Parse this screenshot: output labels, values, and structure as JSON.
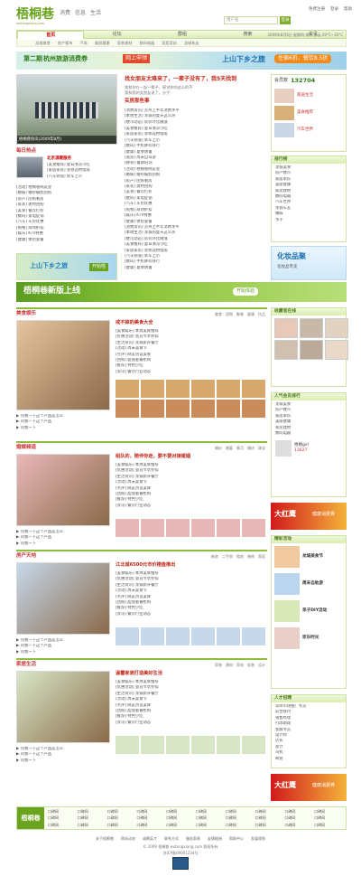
{
  "header": {
    "logo": "梧桐巷",
    "logo_sub": "wutongxiang.com",
    "tabs": [
      "消费",
      "信息",
      "生活"
    ],
    "toplinks": [
      "免费注册",
      "登录",
      "帮助"
    ],
    "search_placeholder": "用户名",
    "search_btn": "登录",
    "nav": [
      "首页",
      "论坛",
      "群组",
      "搜索",
      "资讯"
    ],
    "subnav": [
      "龙城美食",
      "房产楼市",
      "汽车",
      "美丽健康",
      "家装建材",
      "数码电器",
      "家居家纺",
      "龙城车友"
    ],
    "weather": "2009年8月6日 星期四 常州 多云 29°C~33°C"
  },
  "banner": {
    "left": "第二期",
    "mid": "杭州旅游消费券",
    "chip": "网上申领",
    "right": "上山下乡之旅",
    "right_chip": "住宿6折、餐饮8.5折"
  },
  "headline": {
    "title": "找女朋友太难来了，一辈子没有了，我5天找到",
    "sub1": "我和你在一起一辈子，感觉你的这么的不",
    "sub2": "我和我的女朋友说了，分手"
  },
  "featured_news": [
    "梧桐巷快讯(2009年8月)",
    "问卷调查:家居装饰多选",
    "社区活动:每周小聚",
    "买房那些事",
    "女孩子们说什么"
  ],
  "daily": {
    "title": "每日热点",
    "item": "北京温暖服务"
  },
  "news_block_1": [
    "[消费资讯] 苏州上半年消费水平",
    "[本地生活] 龙城的夏天这么热",
    "[楼市动态] 房价环比微涨",
    "[美食推荐] 夏日清凉小吃",
    "[家居家装] 装修选材指南",
    "[汽车频道] 新车上市",
    "[数码] 手机降价排行",
    "[健康] 夏季防暑",
    "[旅游] 周末自驾游",
    "[教育] 暑期培训"
  ],
  "news_block_2": [
    "[活动] 梧桐巷网友会",
    "[婚嫁] 婚纱摄影团购",
    "[房产] 团购看房",
    "[家装] 建材团购",
    "[美食] 餐饮打折",
    "[数码] 家电促销",
    "[汽车] 车险优惠",
    "[购物] 商场折扣",
    "[娱乐] KTV特惠",
    "[健康] 体检套餐"
  ],
  "activity_banner": {
    "text": "上山下乡之旅",
    "chip": "开始啦"
  },
  "sidebar": {
    "member_title": "会员数",
    "member_count": "132704",
    "links": [
      "家居生活",
      "美食推荐",
      "汽车世界",
      "美丽时尚"
    ],
    "rank_title": "排行榜",
    "rank_items": [
      "龙城美食",
      "房产楼市",
      "家居家纺",
      "美丽健康",
      "家装建材",
      "数码电器",
      "汽车世界",
      "龙城车友",
      "婚嫁",
      "亲子"
    ],
    "ad": "化妆品聚",
    "ad_sub": "化妆品专卖"
  },
  "green_banner": {
    "text": "梧桐巷新版上线",
    "chip": "开始体验"
  },
  "sections": [
    {
      "title": "美食娱乐",
      "head": "戒不掉的美食大全",
      "headline": "戒不掉的美食大全",
      "tags": [
        "美食",
        "团购",
        "聚餐",
        "健康",
        "饮品"
      ]
    },
    {
      "title": "婚嫁频道",
      "head": "婚嫁频道",
      "headline": "组队的，陪伴你走，要不要对接婚姻",
      "tags": [
        "婚纱",
        "婚宴",
        "蜜月",
        "婚庆",
        "珠宝"
      ]
    },
    {
      "title": "房产天地",
      "head": "房产天地",
      "headline": "江北城6500元市价楼盘推出",
      "tags": [
        "新房",
        "二手房",
        "租房",
        "装修",
        "家居"
      ]
    },
    {
      "title": "家居生活",
      "head": "家居生活",
      "headline": "温馨家装打造美好生活",
      "tags": [
        "家装",
        "建材",
        "家电",
        "软装",
        "设计"
      ]
    }
  ],
  "section_news": [
    "[美食娱乐] 本周美食推荐",
    "[优惠活动] 会员专享折扣",
    "[生活资讯] 龙城新开餐厅",
    "[活动] 周末美食节",
    "[点评] 网友热议美食",
    "[团购] 超值套餐抢购",
    "[推荐] 特色小吃",
    "[资讯] 餐饮行业动态"
  ],
  "section_links": [
    "▶ 问我一下这个产品是怎么",
    "▶ 问我一下这个产品",
    "▶ 问我一下"
  ],
  "right_column": {
    "head1": "收藏者在线",
    "head2": "人气会员排行",
    "head3": "精彩活动",
    "head4": "人才招聘",
    "user_name": "梧桐girl",
    "user_count": "13627",
    "act_titles": [
      "龙城美食节",
      "周末自助游",
      "亲子DIY活动",
      "欢乐时光"
    ],
    "jobs": [
      "常州市场推广专员",
      "前台接待",
      "销售经理",
      "行政助理",
      "客服专员",
      "设计师",
      "店长",
      "会计",
      "司机",
      "网管"
    ],
    "ad_text": "大红鹰",
    "ad_chip": "健康消费券"
  },
  "bottom_links": {
    "title": "梧桐巷",
    "cells": [
      "口碑网",
      "口碑网",
      "口碑网",
      "口碑网",
      "口碑网",
      "口碑网",
      "口碑网",
      "口碑网",
      "口碑网",
      "口碑网",
      "口碑网",
      "口碑网",
      "口碑网",
      "口碑网",
      "口碑网",
      "口碑网",
      "口碑网",
      "口碑网",
      "口碑网",
      "口碑网",
      "口碑网",
      "口碑网",
      "口碑网",
      "口碑网",
      "口碑网",
      "口碑网",
      "口碑网",
      "口碑网",
      "口碑网",
      "口碑网"
    ]
  },
  "footer": {
    "links": [
      "关于梧桐巷",
      "网站动态",
      "诚聘英才",
      "联系方式",
      "服务条款",
      "友情链接",
      "帮助中心",
      "发展规划"
    ],
    "copyright": "© 2009 梧桐巷 wutongxiang.com 版权所有",
    "icp": "苏ICP备09001234号"
  }
}
